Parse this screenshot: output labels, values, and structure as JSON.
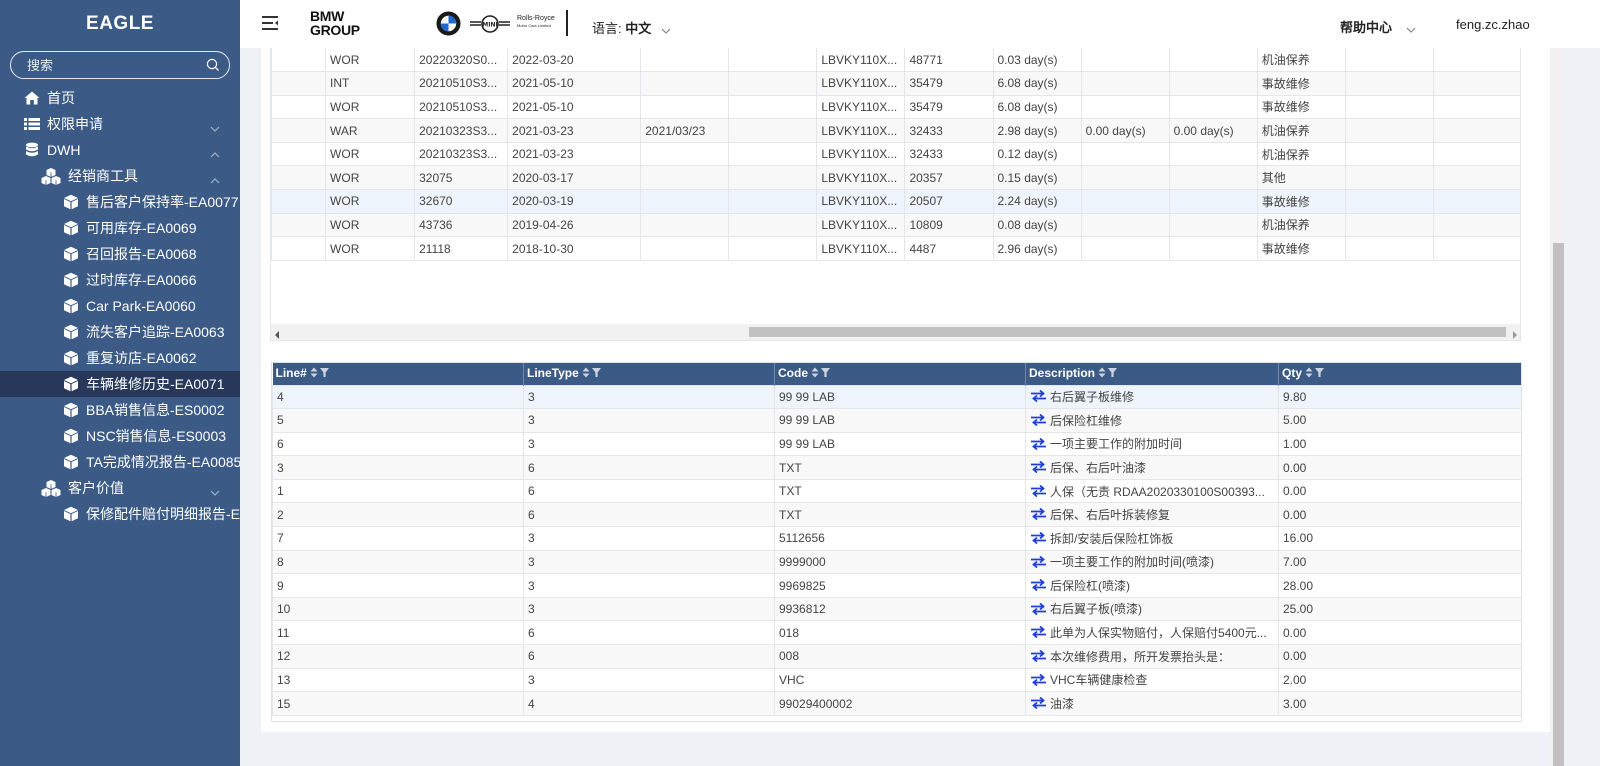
{
  "app": {
    "title": "EAGLE"
  },
  "sidebar": {
    "search_placeholder": "搜索",
    "items": [
      {
        "label": "首页",
        "icon": "home-icon",
        "level": 1
      },
      {
        "label": "权限申请",
        "icon": "list-icon",
        "level": 1,
        "chevron": "down"
      },
      {
        "label": "DWH",
        "icon": "database-icon",
        "level": 1,
        "chevron": "up"
      },
      {
        "label": "经销商工具",
        "icon": "cubes-icon",
        "level": 2,
        "chevron": "up"
      },
      {
        "label": "售后客户保持率-EA0077",
        "icon": "cube-icon",
        "level": 3
      },
      {
        "label": "可用库存-EA0069",
        "icon": "cube-icon",
        "level": 3
      },
      {
        "label": "召回报告-EA0068",
        "icon": "cube-icon",
        "level": 3
      },
      {
        "label": "过时库存-EA0066",
        "icon": "cube-icon",
        "level": 3
      },
      {
        "label": "Car Park-EA0060",
        "icon": "cube-icon",
        "level": 3
      },
      {
        "label": "流失客户追踪-EA0063",
        "icon": "cube-icon",
        "level": 3
      },
      {
        "label": "重复访店-EA0062",
        "icon": "cube-icon",
        "level": 3
      },
      {
        "label": "车辆维修历史-EA0071",
        "icon": "cube-icon",
        "level": 3,
        "active": true
      },
      {
        "label": "BBA销售信息-ES0002",
        "icon": "cube-icon",
        "level": 3
      },
      {
        "label": "NSC销售信息-ES0003",
        "icon": "cube-icon",
        "level": 3
      },
      {
        "label": "TA完成情况报告-EA0085",
        "icon": "cube-icon",
        "level": 3
      },
      {
        "label": "客户价值",
        "icon": "cubes-icon",
        "level": 2,
        "chevron": "down"
      },
      {
        "label": "保修配件赔付明细报告-E/",
        "icon": "cube-icon",
        "level": 3
      }
    ]
  },
  "header": {
    "group_line1": "BMW",
    "group_line2": "GROUP",
    "rr_line1": "Rolls-Royce",
    "rr_line2": "Motor Cars Limited",
    "lang_label": "语言:",
    "lang_value": "中文",
    "help": "帮助中心",
    "user": "feng.zc.zhao"
  },
  "upper_table": {
    "rows": [
      [
        "",
        "WOR",
        "20220320S0...",
        "2022-03-20",
        "",
        "",
        "LBVKY110X...",
        "48771",
        "0.03 day(s)",
        "",
        "",
        "机油保养",
        "",
        ""
      ],
      [
        "",
        "INT",
        "20210510S3...",
        "2021-05-10",
        "",
        "",
        "LBVKY110X...",
        "35479",
        "6.08 day(s)",
        "",
        "",
        "事故维修",
        "",
        ""
      ],
      [
        "",
        "WOR",
        "20210510S3...",
        "2021-05-10",
        "",
        "",
        "LBVKY110X...",
        "35479",
        "6.08 day(s)",
        "",
        "",
        "事故维修",
        "",
        ""
      ],
      [
        "",
        "WAR",
        "20210323S3...",
        "2021-03-23",
        "2021/03/23",
        "",
        "LBVKY110X...",
        "32433",
        "2.98 day(s)",
        "0.00 day(s)",
        "0.00 day(s)",
        "机油保养",
        "",
        ""
      ],
      [
        "",
        "WOR",
        "20210323S3...",
        "2021-03-23",
        "",
        "",
        "LBVKY110X...",
        "32433",
        "0.12 day(s)",
        "",
        "",
        "机油保养",
        "",
        ""
      ],
      [
        "",
        "WOR",
        "32075",
        "2020-03-17",
        "",
        "",
        "LBVKY110X...",
        "20357",
        "0.15 day(s)",
        "",
        "",
        "其他",
        "",
        ""
      ],
      [
        "",
        "WOR",
        "32670",
        "2020-03-19",
        "",
        "",
        "LBVKY110X...",
        "20507",
        "2.24 day(s)",
        "",
        "",
        "事故维修",
        "",
        ""
      ],
      [
        "",
        "WOR",
        "43736",
        "2019-04-26",
        "",
        "",
        "LBVKY110X...",
        "10809",
        "0.08 day(s)",
        "",
        "",
        "机油保养",
        "",
        ""
      ],
      [
        "",
        "WOR",
        "21118",
        "2018-10-30",
        "",
        "",
        "LBVKY110X...",
        "4487",
        "2.96 day(s)",
        "",
        "",
        "事故维修",
        "",
        ""
      ]
    ],
    "highlight_row": 6
  },
  "lower_table": {
    "columns": [
      "Line#",
      "LineType",
      "Code",
      "Description",
      "Qty"
    ],
    "rows": [
      [
        "4",
        "3",
        "99 99 LAB",
        "右后翼子板维修",
        "9.80"
      ],
      [
        "5",
        "3",
        "99 99 LAB",
        "后保险杠维修",
        "5.00"
      ],
      [
        "6",
        "3",
        "99 99 LAB",
        "一项主要工作的附加时间",
        "1.00"
      ],
      [
        "3",
        "6",
        "TXT",
        "后保、右后叶油漆",
        "0.00"
      ],
      [
        "1",
        "6",
        "TXT",
        "人保（无责 RDAA2020330100S00393...",
        "0.00"
      ],
      [
        "2",
        "6",
        "TXT",
        "后保、右后叶拆装修复",
        "0.00"
      ],
      [
        "7",
        "3",
        "5112656",
        "拆卸/安装后保险杠饰板",
        "16.00"
      ],
      [
        "8",
        "3",
        "9999000",
        "一项主要工作的附加时间(喷漆)",
        "7.00"
      ],
      [
        "9",
        "3",
        "9969825",
        "后保险杠(喷漆)",
        "28.00"
      ],
      [
        "10",
        "3",
        "9936812",
        "右后翼子板(喷漆)",
        "25.00"
      ],
      [
        "11",
        "6",
        "018",
        "此单为人保实物赔付，人保赔付5400元...",
        "0.00"
      ],
      [
        "12",
        "6",
        "008",
        "本次维修费用，所开发票抬头是：",
        "0.00"
      ],
      [
        "13",
        "3",
        "VHC",
        "VHC车辆健康检查",
        "2.00"
      ],
      [
        "15",
        "4",
        "99029400002",
        "油漆",
        "3.00"
      ]
    ],
    "highlight_row": 0
  },
  "colors": {
    "sidebar_bg": "#3b5a86",
    "sidebar_active": "#27385a",
    "table_header_bg": "#3b5a86",
    "row_highlight": "#eef4fb",
    "swap_icon": "#1f3fd6"
  }
}
